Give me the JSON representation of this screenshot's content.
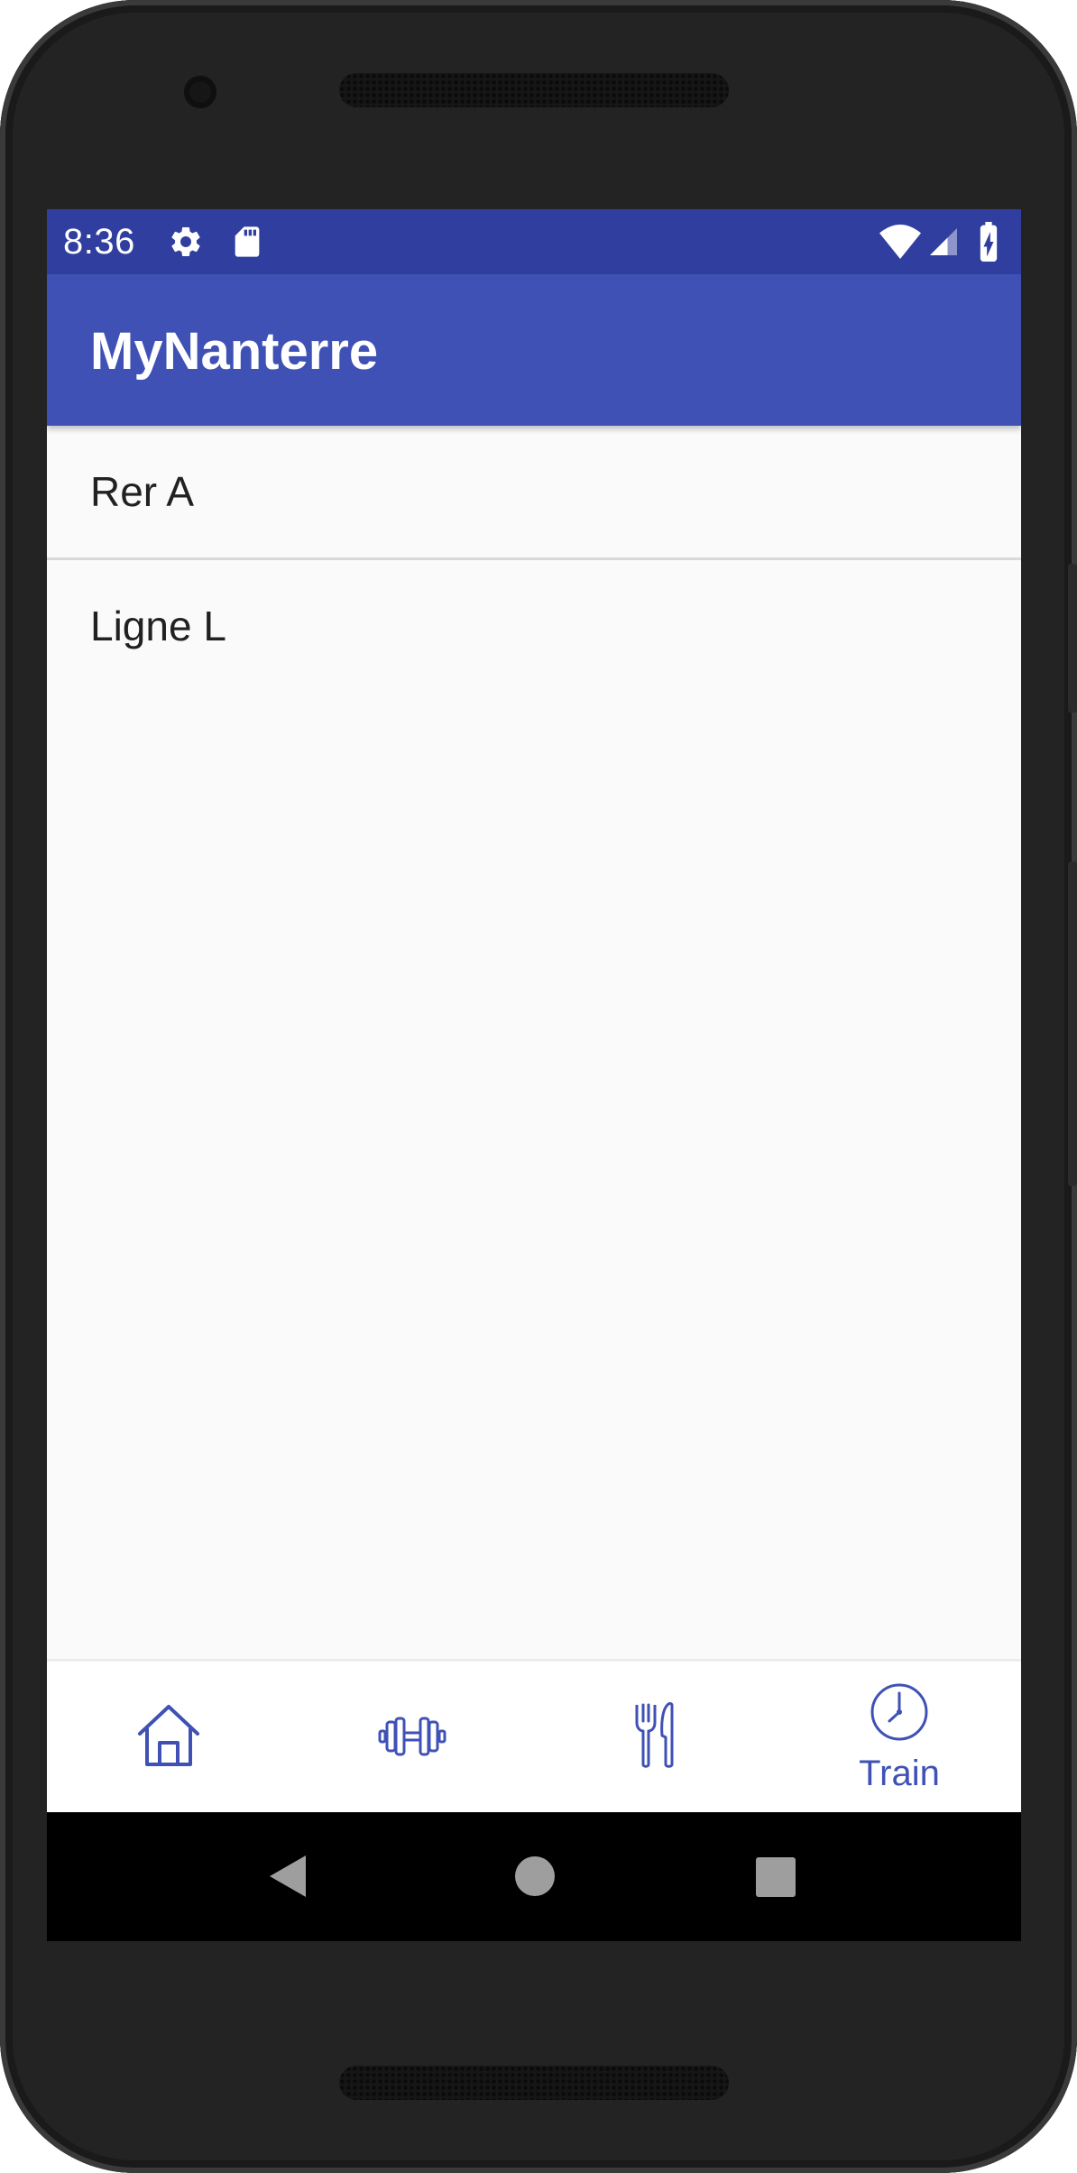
{
  "status_bar": {
    "time": "8:36",
    "left_icons": [
      "settings-gear-icon",
      "sd-card-icon"
    ],
    "right_icons": [
      "wifi-icon",
      "cell-signal-icon",
      "battery-charging-icon"
    ]
  },
  "app_bar": {
    "title": "MyNanterre"
  },
  "list": {
    "items": [
      {
        "label": "Rer A"
      },
      {
        "label": "Ligne L"
      }
    ]
  },
  "bottom_nav": {
    "items": [
      {
        "icon": "home-icon",
        "label": ""
      },
      {
        "icon": "dumbbell-icon",
        "label": ""
      },
      {
        "icon": "fork-knife-icon",
        "label": ""
      },
      {
        "icon": "clock-icon",
        "label": "Train",
        "selected": true
      }
    ]
  },
  "system_nav": {
    "buttons": [
      "back-icon",
      "home-circle-icon",
      "recents-square-icon"
    ]
  },
  "colors": {
    "status_bar": "#303f9f",
    "app_bar": "#3f51b5",
    "accent": "#3f51b5",
    "background": "#fafafa",
    "text": "#212121"
  }
}
